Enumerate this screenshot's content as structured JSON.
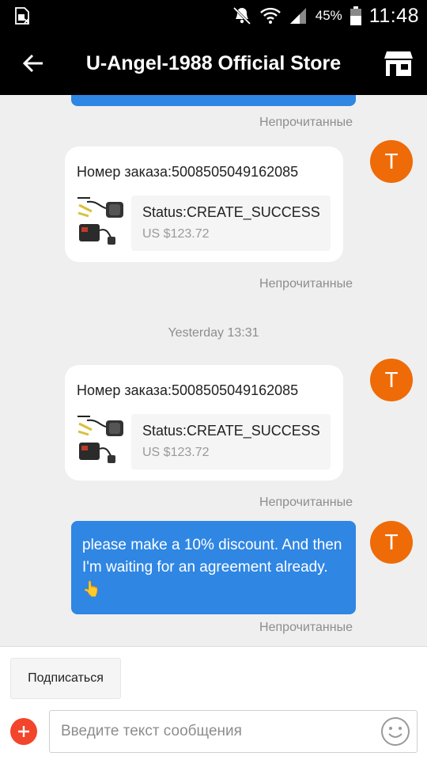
{
  "status_bar": {
    "battery_percent": "45%",
    "time": "11:48",
    "icons": [
      "sim-card-icon",
      "mute-icon",
      "wifi-icon",
      "signal-icon",
      "battery-icon"
    ]
  },
  "header": {
    "title": "U-Angel-1988 Official Store",
    "back_icon": "back-arrow-icon",
    "store_icon": "store-icon"
  },
  "chat": {
    "messages": [
      {
        "type": "status",
        "unread_label": "Непрочитанные"
      },
      {
        "type": "order",
        "order_label": "Номер заказа:5008505049162085",
        "status": "Status:CREATE_SUCCESS",
        "price": "US $123.72",
        "avatar_letter": "T",
        "unread_label": "Непрочитанные"
      },
      {
        "type": "timestamp",
        "text": "Yesterday 13:31"
      },
      {
        "type": "order",
        "order_label": "Номер заказа:5008505049162085",
        "status": "Status:CREATE_SUCCESS",
        "price": "US $123.72",
        "avatar_letter": "T",
        "unread_label": "Непрочитанные"
      },
      {
        "type": "text",
        "text": "please make a 10% discount.  And then I'm waiting for an agreement already.",
        "emoji": "👆",
        "avatar_letter": "T",
        "unread_label": "Непрочитанные"
      }
    ]
  },
  "composer": {
    "subscribe_label": "Подписаться",
    "input_placeholder": "Введите текст сообщения",
    "input_value": "",
    "plus_icon": "plus-icon",
    "emoji_icon": "smiley-icon"
  },
  "colors": {
    "accent_blue": "#2f86e3",
    "avatar_orange": "#ee6b08",
    "plus_red": "#f2452b",
    "header_bg": "#000000"
  }
}
